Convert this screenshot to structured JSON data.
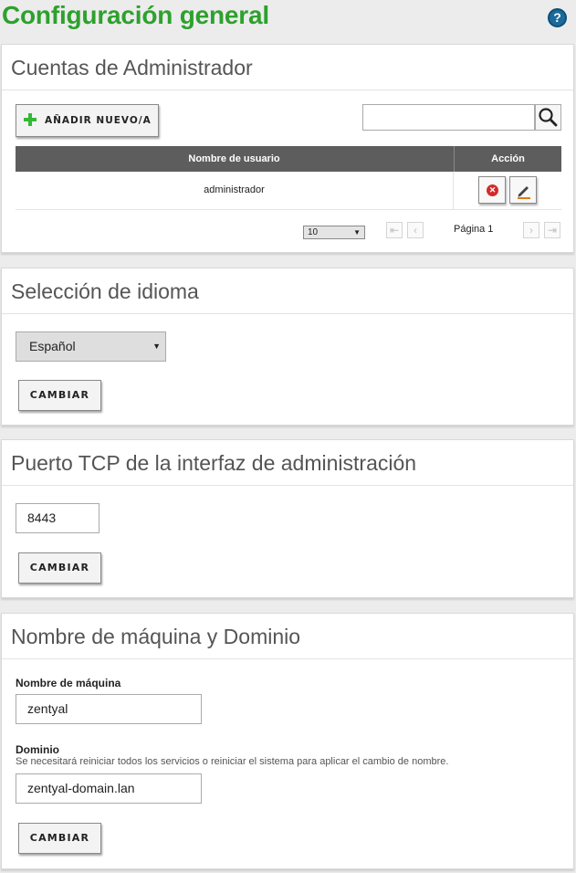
{
  "header": {
    "title": "Configuración general",
    "help_icon": "?"
  },
  "admins": {
    "title": "Cuentas de Administrador",
    "add_label": "AÑADIR NUEVO/A",
    "search": {
      "value": "",
      "placeholder": ""
    },
    "columns": [
      "Nombre de usuario",
      "Acción"
    ],
    "rows": [
      {
        "username": "administrador"
      }
    ],
    "pagination": {
      "page_size": "10",
      "page_label": "Página 1"
    }
  },
  "language": {
    "title": "Selección de idioma",
    "selected": "Español",
    "change_label": "CAMBIAR"
  },
  "port": {
    "title": "Puerto TCP de la interfaz de administración",
    "value": "8443",
    "change_label": "CAMBIAR"
  },
  "host": {
    "title": "Nombre de máquina y Dominio",
    "hostname_label": "Nombre de máquina",
    "hostname_value": "zentyal",
    "domain_label": "Dominio",
    "domain_help": "Se necesitará reiniciar todos los servicios o reiniciar el sistema para aplicar el cambio de nombre.",
    "domain_value": "zentyal-domain.lan",
    "change_label": "CAMBIAR"
  },
  "colors": {
    "title_green": "#2da12d",
    "table_header": "#5d5d5d",
    "help_blue": "#1a6b9b",
    "delete_red": "#d42a2a"
  },
  "icons": [
    "help-icon",
    "plus-icon",
    "search-icon",
    "delete-icon",
    "pencil-icon",
    "first-page-icon",
    "prev-page-icon",
    "next-page-icon",
    "last-page-icon"
  ]
}
